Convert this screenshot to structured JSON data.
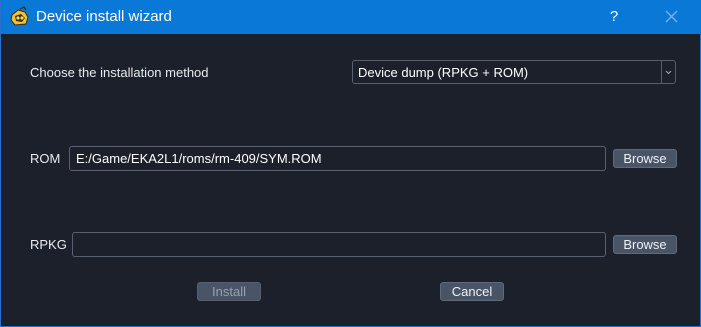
{
  "window": {
    "title": "Device install wizard",
    "help_label": "?"
  },
  "method": {
    "label": "Choose the installation method",
    "selected": "Device dump (RPKG + ROM)"
  },
  "rom": {
    "label": "ROM",
    "value": "E:/Game/EKA2L1/roms/rm-409/SYM.ROM",
    "browse_label": "Browse"
  },
  "rpkg": {
    "label": "RPKG",
    "value": "",
    "browse_label": "Browse"
  },
  "actions": {
    "install_label": "Install",
    "cancel_label": "Cancel"
  },
  "icons": {
    "app": "yellow-device-icon",
    "close": "close-icon",
    "dropdown": "chevron-down-icon"
  },
  "colors": {
    "titlebar": "#0a78d7",
    "background": "#1b202a",
    "button": "#4a5467",
    "border": "#566071"
  }
}
